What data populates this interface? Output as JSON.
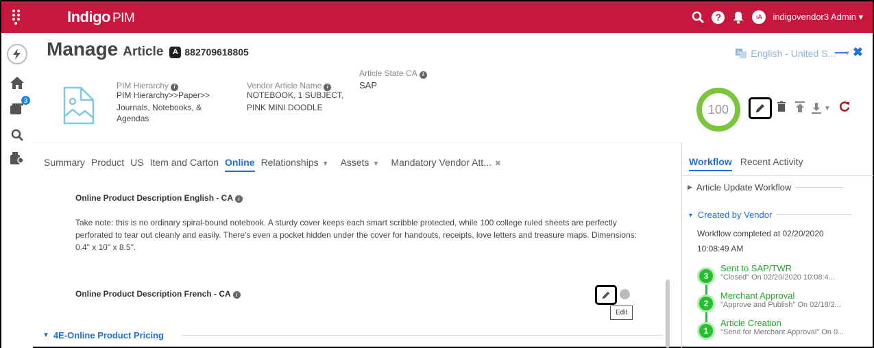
{
  "app": {
    "logo_main": "Indigo",
    "logo_sub": "PIM",
    "user_avatar": "iA",
    "user_name": "indigovendor3 Admin"
  },
  "sidebar": {
    "badge_count": "3"
  },
  "header": {
    "title_big": "Manage",
    "title_article": "Article",
    "article_badge": "A",
    "article_number": "882709618805",
    "language": "English - United S...",
    "score": "100"
  },
  "fields": {
    "pim_hierarchy_label": "PIM Hierarchy",
    "pim_hierarchy_value_1": "PIM Hierarchy>>Paper>>",
    "pim_hierarchy_value_2": "Journals, Notebooks, &",
    "pim_hierarchy_value_3": "Agendas",
    "vendor_name_label": "Vendor Article Name",
    "vendor_name_value_1": "NOTEBOOK, 1 SUBJECT,",
    "vendor_name_value_2": "PINK MINI DOODLE",
    "state_label": "Article State CA",
    "state_value": "SAP"
  },
  "tabs": [
    {
      "label": "Summary"
    },
    {
      "label": "Product"
    },
    {
      "label": "US"
    },
    {
      "label": "Item and Carton"
    },
    {
      "label": "Online"
    },
    {
      "label": "Relationships"
    },
    {
      "label": "Assets"
    },
    {
      "label": "Mandatory Vendor Att..."
    }
  ],
  "content": {
    "desc_en_title": "Online Product Description English - CA",
    "desc_en_text": "Take note: this is no ordinary spiral-bound notebook. A sturdy cover keeps each smart scribble protected, while 100 college ruled sheets are perfectly perforated to tear out cleanly and easily. There's even a pocket hidden under the cover for handouts, receipts, love letters and treasure maps. Dimensions: 0.4\" x 10\" x 8.5\".",
    "desc_fr_title": "Online Product Description French - CA",
    "edit_tooltip": "Edit",
    "pricing_section": "4E-Online Product Pricing"
  },
  "right_panel": {
    "tab_workflow": "Workflow",
    "tab_recent": "Recent Activity",
    "article_update_workflow": "Article Update Workflow",
    "created_by_vendor": "Created by Vendor",
    "completed_line_1": "Workflow completed at 02/20/2020",
    "completed_line_2": "10:08:49 AM",
    "steps": [
      {
        "num": "3",
        "title": "Sent to SAP/TWR",
        "sub": "\"Closed\" On 02/20/2020 10:08:4..."
      },
      {
        "num": "2",
        "title": "Merchant Approval",
        "sub": "\"Approve and Publish\" On 02/18/2..."
      },
      {
        "num": "1",
        "title": "Article Creation",
        "sub": "\"Send for Merchant Approval\" On 0..."
      }
    ]
  },
  "colors": {
    "brand": "#c8163f",
    "accent": "#1e6fd9",
    "success": "#22c02a",
    "score_ring": "#7cc53a"
  }
}
